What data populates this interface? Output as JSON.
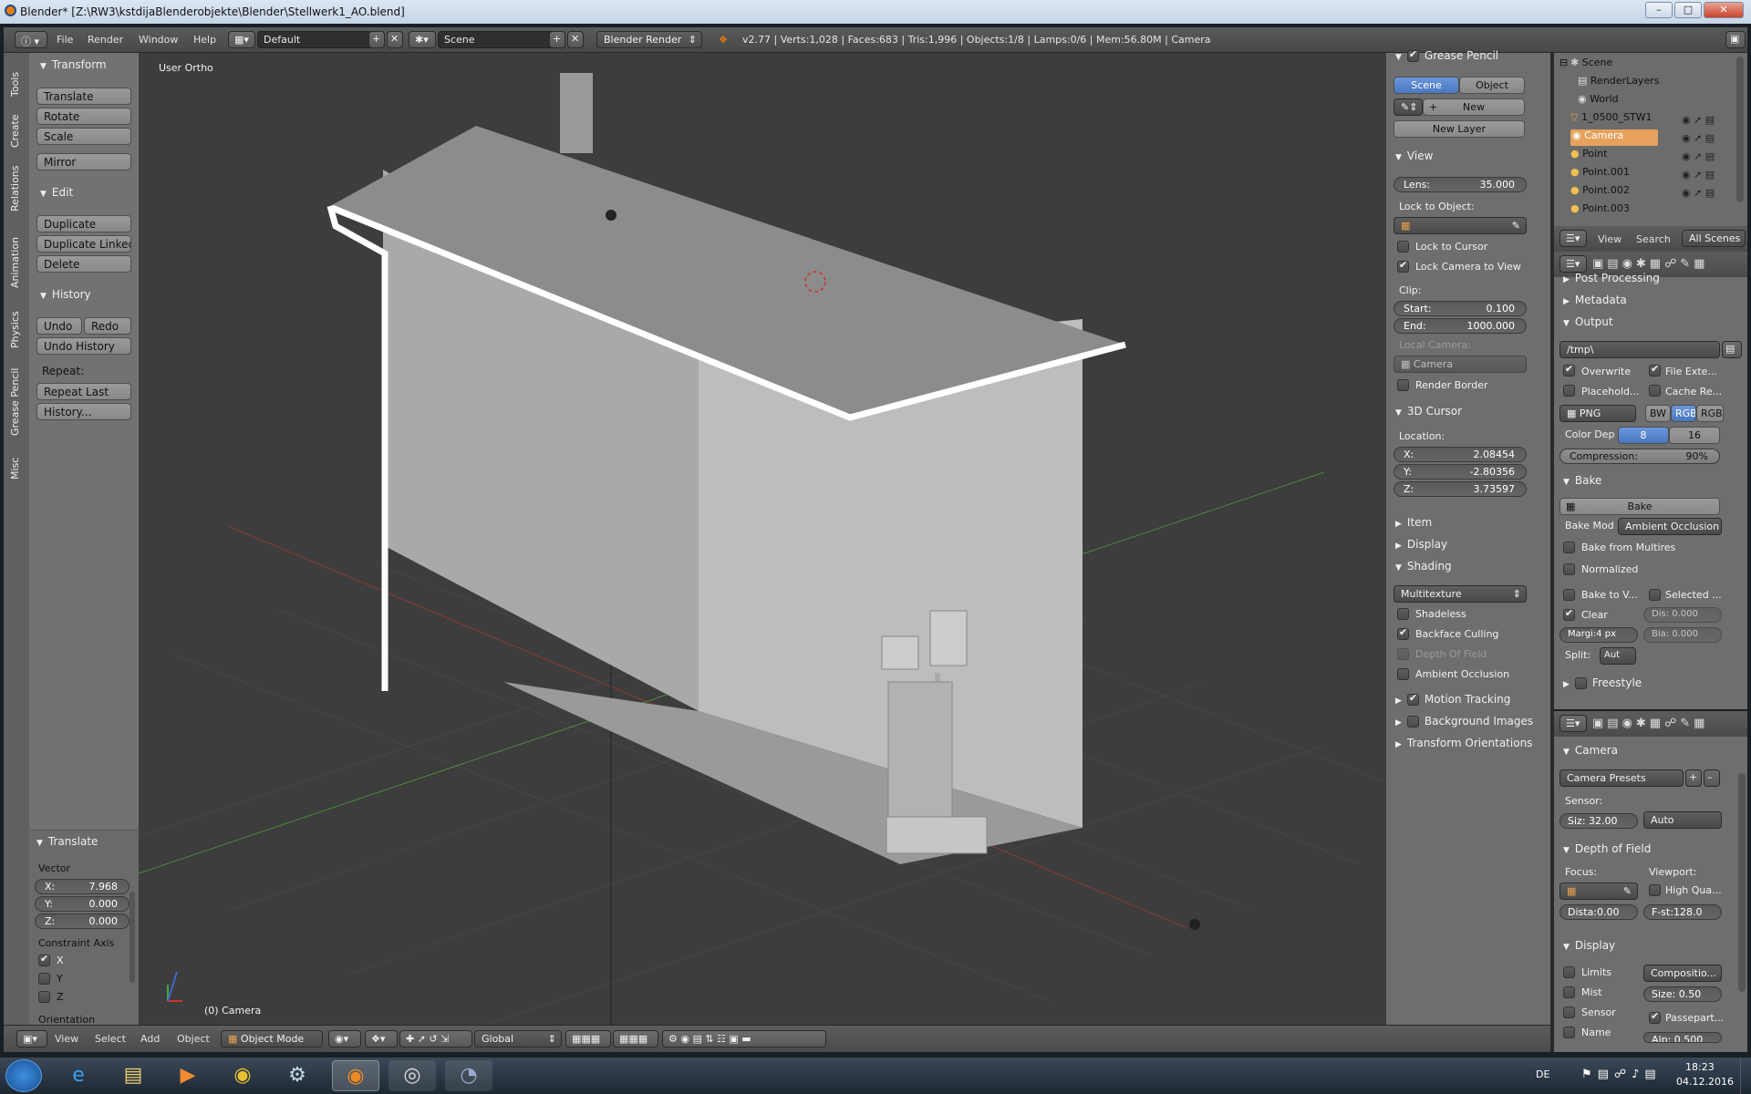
{
  "window": {
    "title": "Blender* [Z:\\RW3\\kstdijaBlenderobjekte\\Blender\\Stellwerk1_AO.blend]"
  },
  "info_header": {
    "menus": [
      "File",
      "Render",
      "Window",
      "Help"
    ],
    "layout": "Default",
    "scene": "Scene",
    "engine": "Blender Render",
    "stats": "v2.77 | Verts:1,028 | Faces:683 | Tris:1,996 | Objects:1/8 | Lamps:0/6 | Mem:56.80M | Camera"
  },
  "tool_tabs": [
    "Tools",
    "Create",
    "Relations",
    "Animation",
    "Physics",
    "Grease Pencil",
    "Misc"
  ],
  "toolshelf": {
    "transform": {
      "title": "Transform",
      "buttons": [
        "Translate",
        "Rotate",
        "Scale",
        "Mirror"
      ]
    },
    "edit": {
      "title": "Edit",
      "buttons": [
        "Duplicate",
        "Duplicate Linked",
        "Delete"
      ]
    },
    "history": {
      "title": "History",
      "undo": "Undo",
      "redo": "Redo",
      "undo_history": "Undo History",
      "repeat_label": "Repeat:",
      "repeat_last": "Repeat Last",
      "history_btn": "History..."
    }
  },
  "operator_panel": {
    "title": "Translate",
    "vector_label": "Vector",
    "x": {
      "label": "X:",
      "value": "7.968"
    },
    "y": {
      "label": "Y:",
      "value": "0.000"
    },
    "z": {
      "label": "Z:",
      "value": "0.000"
    },
    "constraint_label": "Constraint Axis",
    "axes": [
      {
        "label": "X",
        "checked": true
      },
      {
        "label": "Y",
        "checked": false
      },
      {
        "label": "Z",
        "checked": false
      }
    ],
    "orientation_label": "Orientation"
  },
  "viewport": {
    "view_name": "User Ortho",
    "object_label": "(0) Camera"
  },
  "viewport_header": {
    "menus": [
      "View",
      "Select",
      "Add",
      "Object"
    ],
    "mode": "Object Mode",
    "orientation": "Global"
  },
  "properties_n": {
    "grease_pencil": {
      "title": "Grease Pencil",
      "scene": "Scene",
      "object": "Object",
      "new": "New",
      "new_layer": "New Layer"
    },
    "view": {
      "title": "View",
      "lens": {
        "label": "Lens:",
        "value": "35.000"
      },
      "lock_object": "Lock to Object:",
      "lock_cursor": "Lock to Cursor",
      "lock_camera": "Lock Camera to View",
      "clip": "Clip:",
      "start": {
        "label": "Start:",
        "value": "0.100"
      },
      "end": {
        "label": "End:",
        "value": "1000.000"
      },
      "local_camera": "Local Camera:",
      "camera": "Camera",
      "render_border": "Render Border"
    },
    "cursor": {
      "title": "3D Cursor",
      "location": "Location:",
      "x": {
        "label": "X:",
        "value": "2.08454"
      },
      "y": {
        "label": "Y:",
        "value": "-2.80356"
      },
      "z": {
        "label": "Z:",
        "value": "3.73597"
      }
    },
    "item": "Item",
    "display": "Display",
    "shading": {
      "title": "Shading",
      "mode": "Multitexture",
      "shadeless": "Shadeless",
      "backface": "Backface Culling",
      "dof": "Depth Of Field",
      "ao": "Ambient Occlusion"
    },
    "motion_tracking": "Motion Tracking",
    "background_images": "Background Images",
    "transform_orientations": "Transform Orientations"
  },
  "outliner": {
    "items": [
      {
        "name": "Scene",
        "icon": "scene-icon",
        "indent": 0
      },
      {
        "name": "RenderLayers",
        "icon": "renderlayers-icon",
        "indent": 1
      },
      {
        "name": "World",
        "icon": "world-icon",
        "indent": 1
      },
      {
        "name": "1_0500_STW1",
        "icon": "mesh-icon",
        "indent": 1
      },
      {
        "name": "Camera",
        "icon": "camera-icon",
        "indent": 1
      },
      {
        "name": "Point",
        "icon": "lamp-icon",
        "indent": 1
      },
      {
        "name": "Point.001",
        "icon": "lamp-icon",
        "indent": 1
      },
      {
        "name": "Point.002",
        "icon": "lamp-icon",
        "indent": 1
      },
      {
        "name": "Point.003",
        "icon": "lamp-icon",
        "indent": 1
      }
    ],
    "header": {
      "view": "View",
      "search": "Search",
      "all_scenes": "All Scenes"
    }
  },
  "render_props": {
    "post_processing": "Post Processing",
    "metadata": "Metadata",
    "output": {
      "title": "Output",
      "path": "/tmp\\",
      "overwrite": "Overwrite",
      "file_ext": "File Exte...",
      "placeholders": "Placehold...",
      "cache": "Cache Re...",
      "format": "PNG",
      "bw": "BW",
      "rgb": "RGB",
      "rgba": "RGB",
      "color_depth": "Color Dep",
      "d8": "8",
      "d16": "16",
      "compression": {
        "label": "Compression:",
        "value": "90%"
      }
    },
    "bake": {
      "title": "Bake",
      "button": "Bake",
      "mode_label": "Bake Mod",
      "mode": "Ambient Occlusion",
      "from_multires": "Bake from Multires",
      "normalized": "Normalized",
      "to_vertex": "Bake to V...",
      "selected": "Selected ...",
      "clear": "Clear",
      "dist": "Dis: 0.000",
      "margin": "Margi:4 px",
      "bias": "Bia: 0.000",
      "split_label": "Split:",
      "split": "Aut"
    },
    "freestyle": "Freestyle"
  },
  "camera_props": {
    "camera": {
      "title": "Camera",
      "presets": "Camera Presets",
      "sensor": "Sensor:",
      "size": "Siz: 32.00",
      "fit": "Auto"
    },
    "dof": {
      "title": "Depth of Field",
      "focus": "Focus:",
      "viewport": "Viewport:",
      "high_quality": "High Qua...",
      "distance": "Dista:0.00",
      "fstop": "F-st:128.0"
    },
    "display": {
      "title": "Display",
      "limits": "Limits",
      "composition": "Compositio...",
      "mist": "Mist",
      "size": "Size: 0.50",
      "sensor": "Sensor",
      "passepartout": "Passepart...",
      "name": "Name",
      "alpha": "Alp: 0.500"
    }
  },
  "taskbar": {
    "lang": "DE",
    "time": "18:23",
    "date": "04.12.2016"
  }
}
